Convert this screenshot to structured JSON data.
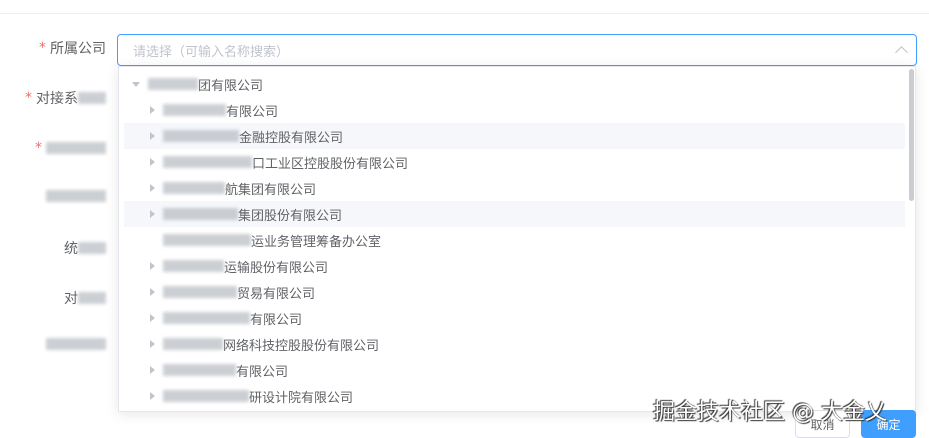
{
  "form": {
    "company_label": "所属公司",
    "labels": [
      {
        "visible": "对接系",
        "required": true
      },
      {
        "visible": "",
        "required": true
      },
      {
        "visible": "",
        "required": false
      },
      {
        "visible": "统",
        "required": false
      },
      {
        "visible": "对",
        "required": false
      },
      {
        "visible": "",
        "required": false
      }
    ],
    "company_placeholder": "请选择（可输入名称搜索）"
  },
  "tree": [
    {
      "text": "团有限公司",
      "level": 0,
      "expanded": true
    },
    {
      "text": "有限公司",
      "level": 1
    },
    {
      "text": "金融控股有限公司",
      "level": 1,
      "hover": true
    },
    {
      "text": "口工业区控股股份有限公司",
      "level": 1
    },
    {
      "text": "航集团有限公司",
      "level": 1
    },
    {
      "text": "集团股份有限公司",
      "level": 1,
      "hover": true
    },
    {
      "text": "运业务管理筹备办公室",
      "level": 1,
      "leaf": true
    },
    {
      "text": "运输股份有限公司",
      "level": 1
    },
    {
      "text": "贸易有限公司",
      "level": 1
    },
    {
      "text": "有限公司",
      "level": 1
    },
    {
      "text": "网络科技控股股份有限公司",
      "level": 1
    },
    {
      "text": "有限公司",
      "level": 1
    },
    {
      "text": "研设计院有限公司",
      "level": 1
    }
  ],
  "buttons": {
    "cancel": "取消",
    "confirm": "确定"
  },
  "watermark": "掘金技术社区 @ 大金乂"
}
